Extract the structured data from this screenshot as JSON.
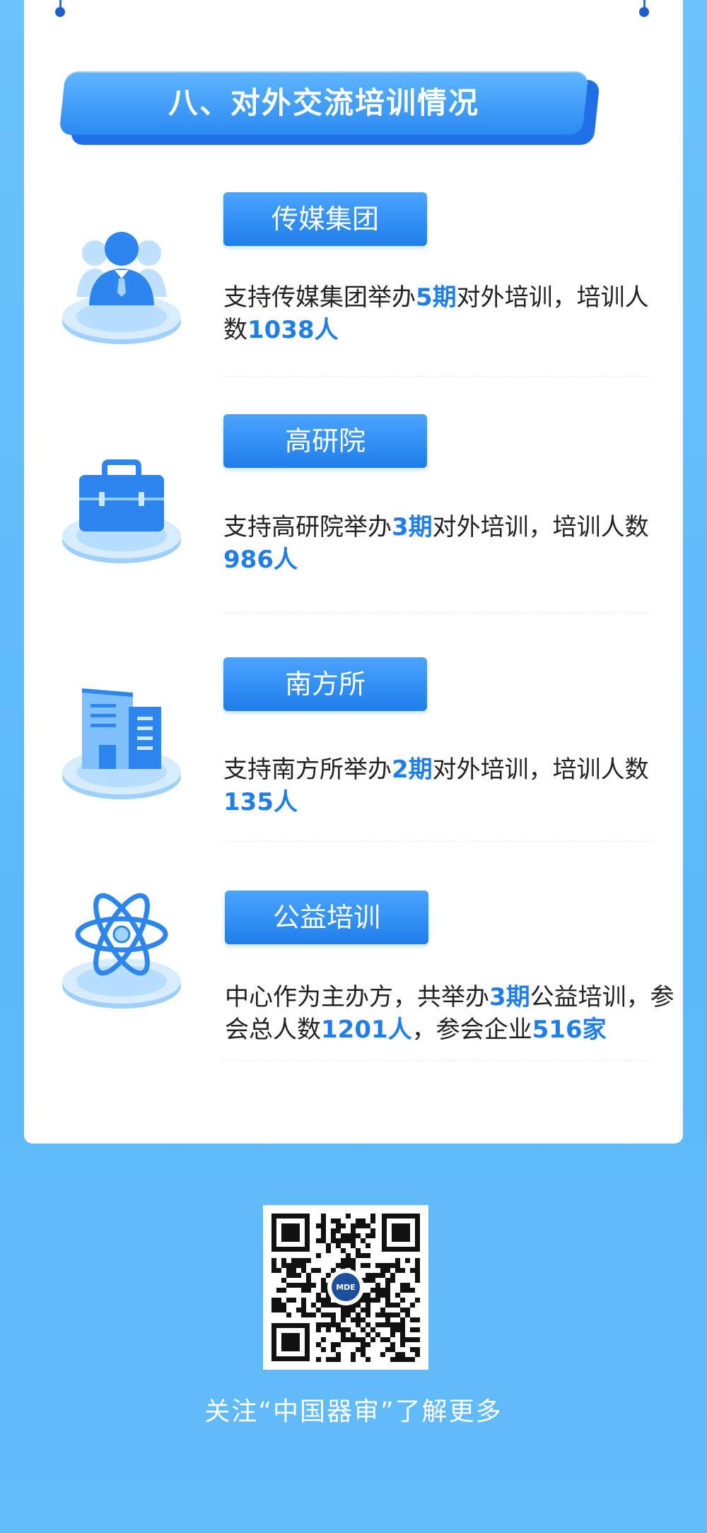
{
  "title": "八、对外交流培训情况",
  "items": [
    {
      "tag": "传媒集团",
      "icon": "person-icon",
      "desc": {
        "p1": "支持传媒集团举办",
        "h1": "5期",
        "p2": "对外培训，培训人数",
        "h2": "1038人",
        "p3": "",
        "h3": ""
      }
    },
    {
      "tag": "高研院",
      "icon": "briefcase-icon",
      "desc": {
        "p1": "支持高研院举办",
        "h1": "3期",
        "p2": "对外培训，培训人数",
        "h2": "986人",
        "p3": "",
        "h3": ""
      }
    },
    {
      "tag": "南方所",
      "icon": "building-icon",
      "desc": {
        "p1": "支持南方所举办",
        "h1": "2期",
        "p2": "对外培训，培训人数",
        "h2": "135人",
        "p3": "",
        "h3": ""
      }
    },
    {
      "tag": "公益培训",
      "icon": "atom-icon",
      "desc": {
        "p1": "中心作为主办方，共举办",
        "h1": "3期",
        "p2": "公益培训，参会总人数",
        "h2": "1201人",
        "p3": "，参会企业",
        "h3": "516家"
      }
    }
  ],
  "qr": {
    "icon": "qr-code-icon",
    "logo_text": "MDE"
  },
  "footer": "关注“中国器审”了解更多",
  "colors": {
    "accent": "#1f7eea",
    "background": "#5cb8f8",
    "title": "#2b8af2"
  }
}
